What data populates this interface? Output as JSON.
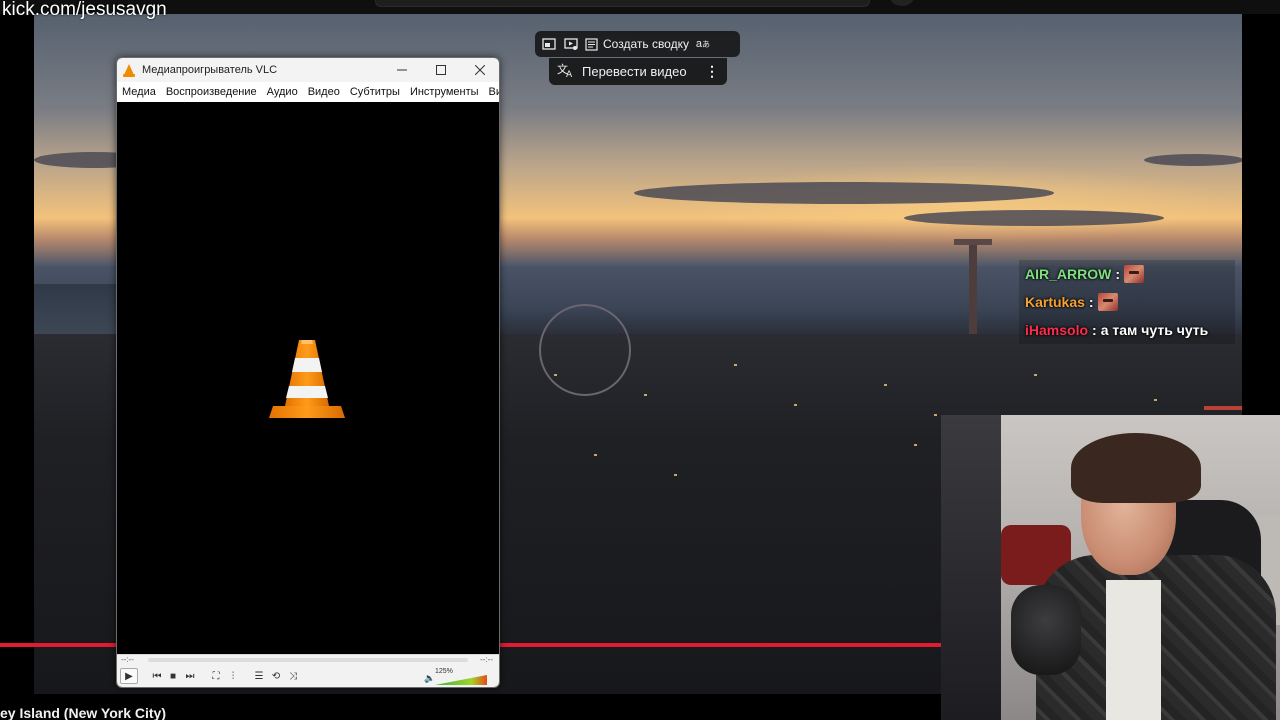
{
  "watermark": "kick.com/jesusavgn",
  "video": {
    "title": "ey Island (New York City)"
  },
  "yt_toolbar": {
    "summary_label": "Создать сводку",
    "translate_label": "Перевести видео",
    "icons": [
      "pip-icon",
      "miniplayer-icon",
      "summary-icon",
      "translate-icon",
      "more-icon"
    ]
  },
  "chat": {
    "messages": [
      {
        "user": "AIR_ARROW",
        "user_color": "#7ee07e",
        "text": "",
        "has_emote": true
      },
      {
        "user": "Kartukas",
        "user_color": "#f6a232",
        "text": "",
        "has_emote": true
      },
      {
        "user": "iHamsolo",
        "user_color": "#ff2c4c",
        "text": "а там чуть чуть",
        "has_emote": false
      }
    ]
  },
  "vlc": {
    "title": "Медиапроигрыватель VLC",
    "menu": [
      "Медиа",
      "Воспроизведение",
      "Аудио",
      "Видео",
      "Субтитры",
      "Инструменты",
      "Вид"
    ],
    "menu_more": "»",
    "time_elapsed": "--:--",
    "time_total": "--:--",
    "volume_label": "125%",
    "volume_level": 1.0,
    "seek_progress": 0.0,
    "accent": "#f08a00"
  },
  "colors": {
    "progress_red": "#e31b32"
  }
}
